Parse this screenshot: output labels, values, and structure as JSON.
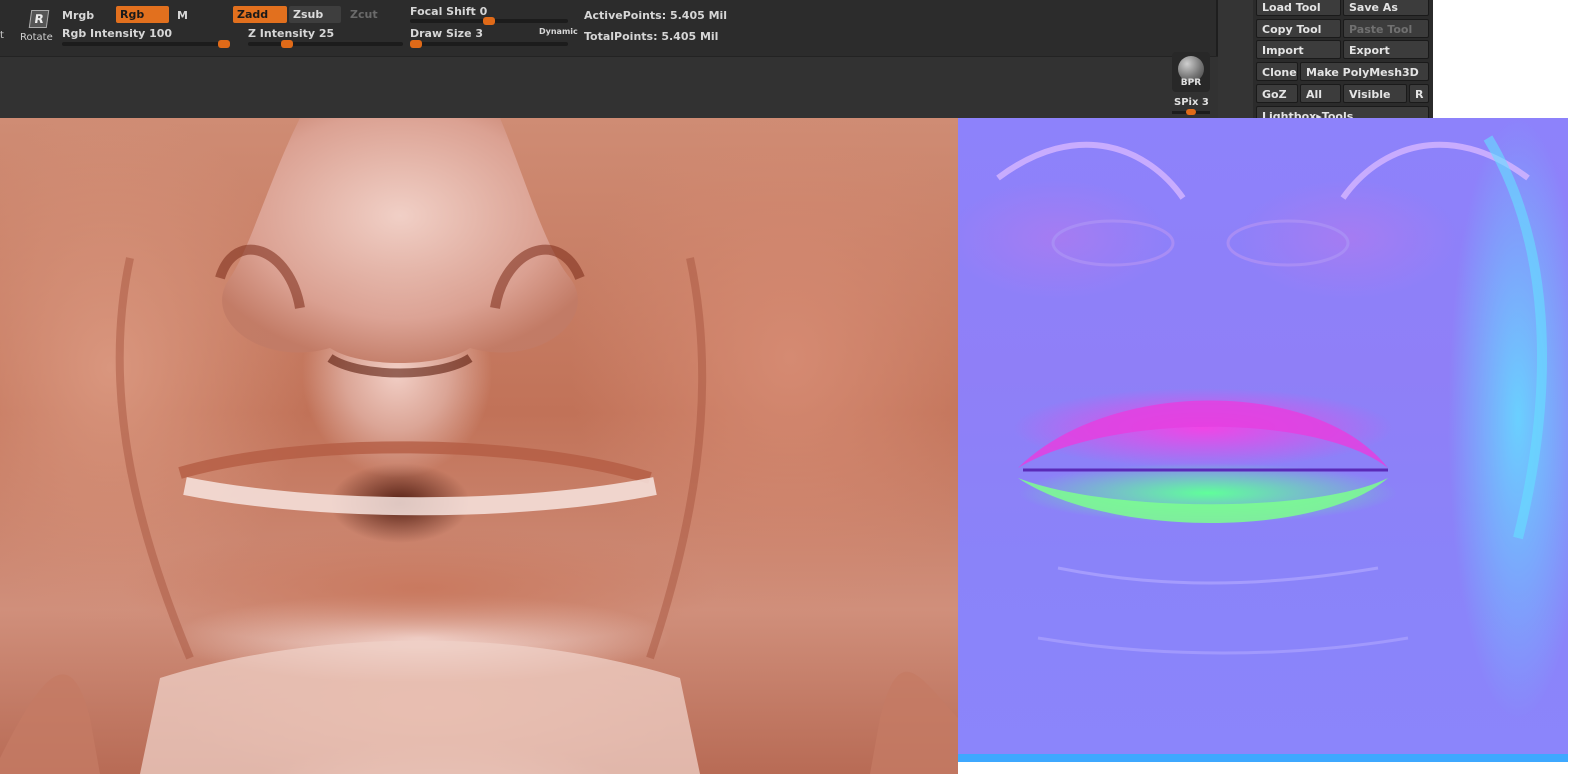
{
  "toolbar": {
    "left_glyph": "t",
    "rotate_key": "R",
    "rotate_label": "Rotate",
    "mrgb": "Mrgb",
    "rgb": "Rgb",
    "m": "M",
    "zadd": "Zadd",
    "zsub": "Zsub",
    "zcut": "Zcut",
    "rgb_intensity_label": "Rgb Intensity",
    "rgb_intensity_value": "100",
    "z_intensity_label": "Z Intensity",
    "z_intensity_value": "25",
    "focal_shift_label": "Focal Shift",
    "focal_shift_value": "0",
    "draw_size_label": "Draw Size",
    "draw_size_value": "3",
    "dynamic_label": "Dynamic",
    "active_points_label": "ActivePoints:",
    "active_points_value": "5.405 Mil",
    "total_points_label": "TotalPoints:",
    "total_points_value": "5.405 Mil",
    "sliders": {
      "rgb_intensity": 1.0,
      "z_intensity": 0.25,
      "focal_shift": 0.5,
      "draw_size": 0.03
    }
  },
  "bpr": {
    "label": "BPR",
    "spix_label": "SPix",
    "spix_value": "3"
  },
  "tool_panel": {
    "load_tool": "Load Tool",
    "save_as": "Save As",
    "copy_tool": "Copy Tool",
    "paste_tool": "Paste Tool",
    "import": "Import",
    "export": "Export",
    "clone": "Clone",
    "make_polymesh": "Make PolyMesh3D",
    "goz": "GoZ",
    "all": "All",
    "visible": "Visible",
    "r": "R",
    "lightbox_tools": "Lightbox▸Tools"
  },
  "colors": {
    "accent": "#e2701e",
    "panel_bg": "#2b2b2b",
    "normal_map_edge": "#3da8ff"
  }
}
